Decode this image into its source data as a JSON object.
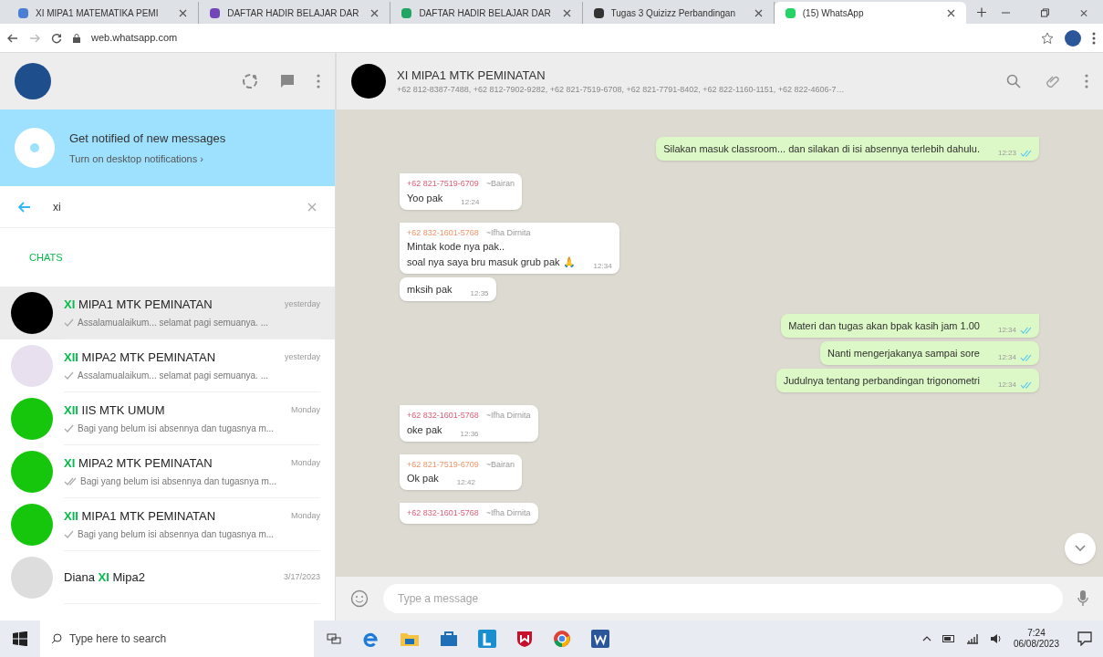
{
  "browser": {
    "tabs": [
      {
        "title": "XI MIPA1 MATEMATIKA PEMI",
        "selected": false,
        "color": "#4a7fd4"
      },
      {
        "title": "DAFTAR HADIR BELAJAR DAR",
        "selected": false,
        "color": "#7248b9"
      },
      {
        "title": "DAFTAR HADIR BELAJAR DAR",
        "selected": false,
        "color": "#21a464"
      },
      {
        "title": "Tugas 3 Quizizz Perbandingan",
        "selected": false,
        "color": "#333333"
      },
      {
        "title": "(15) WhatsApp",
        "selected": true,
        "color": "#25d366"
      }
    ],
    "address": "web.whatsapp.com"
  },
  "notification": {
    "title": "Get notified of new messages",
    "link": "Turn on desktop notifications ›"
  },
  "search": {
    "value": "xi"
  },
  "section_label": "CHATS",
  "chats": [
    {
      "name": "**XI** MIPA1 MTK PEMINATAN",
      "time": "yesterday",
      "preview": "Assalamualaikum... selamat pagi semuanya. ...",
      "delivered": false,
      "color": "#000000",
      "selected": true
    },
    {
      "name": "**XII** MIPA2 MTK PEMINATAN",
      "time": "yesterday",
      "preview": "Assalamualaikum... selamat pagi semuanya. ...",
      "delivered": false,
      "color": "#e8e0ee",
      "selected": false
    },
    {
      "name": "**XII** IIS MTK UMUM",
      "time": "Monday",
      "preview": "Bagi yang belum isi absennya dan tugasnya m...",
      "delivered": false,
      "color": "#16c60c",
      "selected": false
    },
    {
      "name": "**XI** MIPA2 MTK PEMINATAN",
      "time": "Monday",
      "preview": "Bagi yang belum isi absennya dan tugasnya m...",
      "delivered": true,
      "color": "#16c60c",
      "selected": false
    },
    {
      "name": "**XII** MIPA1 MTK PEMINATAN",
      "time": "Monday",
      "preview": "Bagi yang belum isi absennya dan tugasnya m...",
      "delivered": false,
      "color": "#16c60c",
      "selected": false
    },
    {
      "name": "Diana **XI** Mipa2",
      "time": "3/17/2023",
      "color": "#dddddd",
      "selected": false
    }
  ],
  "conversation": {
    "title": "XI MIPA1 MTK PEMINATAN",
    "members": "+62 812-8387-7488, +62 812-7902-9282, +62 821-7519-6708, +62 821-7791-8402, +62 822-1160-1151, +62 822-4606-7…"
  },
  "messages": [
    {
      "kind": "out",
      "text": "Silakan masuk classroom... dan silakan di isi absennya terlebih dahulu.",
      "time": "12:23",
      "group_start": true
    },
    {
      "kind": "in",
      "sender": "+62 821-7519-6709",
      "alias": "~Bairan",
      "text": "Yoo pak",
      "time": "12:24",
      "group_start": true
    },
    {
      "kind": "in",
      "sender": "+62 832-1601-5768",
      "alias": "~Ifha Dirnita",
      "text": "Mintak kode nya pak..\nsoal nya saya bru masuk grub pak 🙏",
      "time": "12:34",
      "group_start": true
    },
    {
      "kind": "in",
      "text": "mksih pak",
      "time": "12:35",
      "group_start": false
    },
    {
      "kind": "out",
      "text": "Materi dan tugas akan bpak kasih jam 1.00",
      "time": "12:34",
      "group_start": true
    },
    {
      "kind": "out",
      "text": "Nanti mengerjakanya sampai sore",
      "time": "12:34",
      "group_start": false
    },
    {
      "kind": "out",
      "text": "Judulnya tentang perbandingan trigonometri",
      "time": "12:34",
      "group_start": false
    },
    {
      "kind": "in",
      "sender": "+62 832-1601-5768",
      "alias": "~Ifha Dirnita",
      "text": "oke pak",
      "time": "12:36",
      "group_start": true
    },
    {
      "kind": "in",
      "sender": "+62 821-7519-6709",
      "alias": "~Bairan",
      "text": "Ok pak",
      "time": "12:42",
      "group_start": true
    },
    {
      "kind": "in",
      "sender": "+62 832-1601-5768",
      "alias": "~Ifha Dirnita",
      "group_start": true
    }
  ],
  "composer": {
    "placeholder": "Type a message"
  },
  "taskbar": {
    "search_placeholder": "Type here to search",
    "time": "7:24",
    "date": "06/08/2023"
  }
}
